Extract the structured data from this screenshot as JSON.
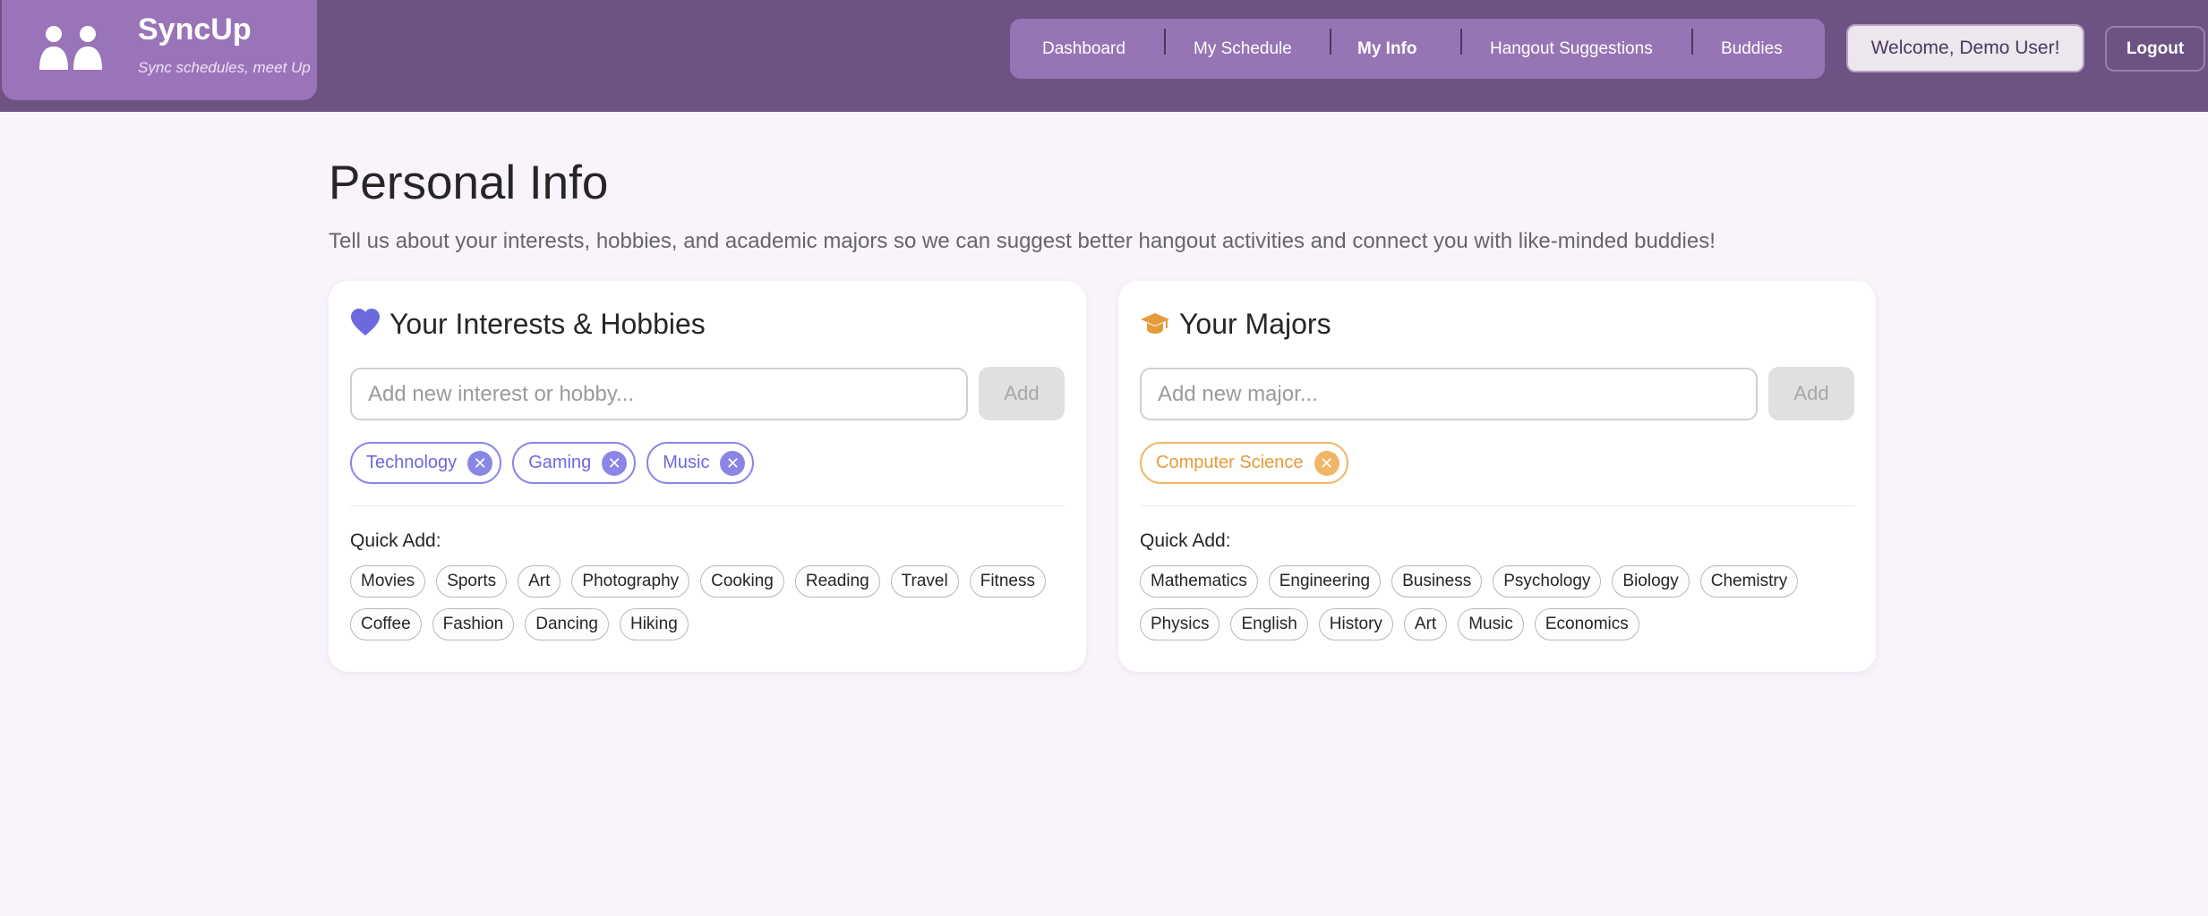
{
  "brand": {
    "name": "SyncUp",
    "tagline": "Sync schedules, meet Up",
    "logo_icon": "people-icon"
  },
  "nav": {
    "items": [
      {
        "label": "Dashboard"
      },
      {
        "label": "My Schedule"
      },
      {
        "label": "My Info",
        "active": true
      },
      {
        "label": "Hangout Suggestions"
      },
      {
        "label": "Buddies"
      }
    ],
    "welcome": "Welcome, Demo User!",
    "logout": "Logout"
  },
  "page": {
    "title": "Personal Info",
    "description": "Tell us about your interests, hobbies, and academic majors so we can suggest better hangout activities and connect you with like-minded buddies!"
  },
  "interests": {
    "title": "Your Interests & Hobbies",
    "icon": "heart-icon",
    "input_placeholder": "Add new interest or hobby...",
    "add_label": "Add",
    "tags": [
      "Technology",
      "Gaming",
      "Music"
    ],
    "quick_label": "Quick Add:",
    "quick": [
      "Movies",
      "Sports",
      "Art",
      "Photography",
      "Cooking",
      "Reading",
      "Travel",
      "Fitness",
      "Coffee",
      "Fashion",
      "Dancing",
      "Hiking"
    ]
  },
  "majors": {
    "title": "Your Majors",
    "icon": "graduation-cap-icon",
    "input_placeholder": "Add new major...",
    "add_label": "Add",
    "tags": [
      "Computer Science"
    ],
    "quick_label": "Quick Add:",
    "quick": [
      "Mathematics",
      "Engineering",
      "Business",
      "Psychology",
      "Biology",
      "Chemistry",
      "Physics",
      "English",
      "History",
      "Art",
      "Music",
      "Economics"
    ]
  },
  "colors": {
    "header": "#6c5384",
    "brand_bg": "#9a74b8",
    "nav_bg": "#9675b4",
    "page_bg": "#f9f4fb",
    "interest_accent": "#6c68de",
    "major_accent": "#e69b3a"
  }
}
